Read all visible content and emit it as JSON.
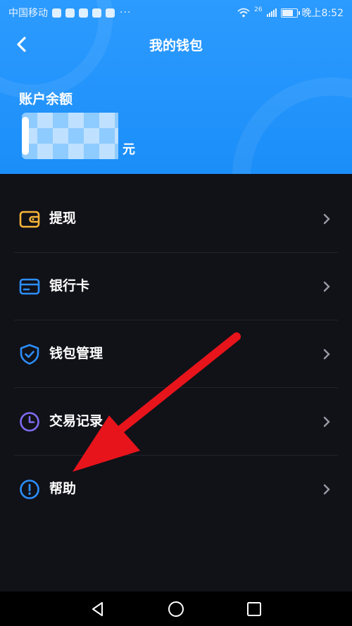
{
  "status_bar": {
    "carrier": "中国移动",
    "dots": "···",
    "network": "26",
    "time": "晚上8:52"
  },
  "header": {
    "title": "我的钱包",
    "balance_label": "账户余额",
    "balance_unit": "元"
  },
  "menu": {
    "items": [
      {
        "label": "提现",
        "icon": "wallet-icon",
        "color": "#f5b53a"
      },
      {
        "label": "银行卡",
        "icon": "card-icon",
        "color": "#2c8ef8"
      },
      {
        "label": "钱包管理",
        "icon": "shield-check-icon",
        "color": "#2c8ef8"
      },
      {
        "label": "交易记录",
        "icon": "clock-icon",
        "color": "#7b6cf0"
      },
      {
        "label": "帮助",
        "icon": "info-icon",
        "color": "#2c8ef8"
      }
    ]
  },
  "colors": {
    "header_blue": "#1b8ef8",
    "background": "#111118",
    "annotation_arrow": "#e8141b"
  }
}
